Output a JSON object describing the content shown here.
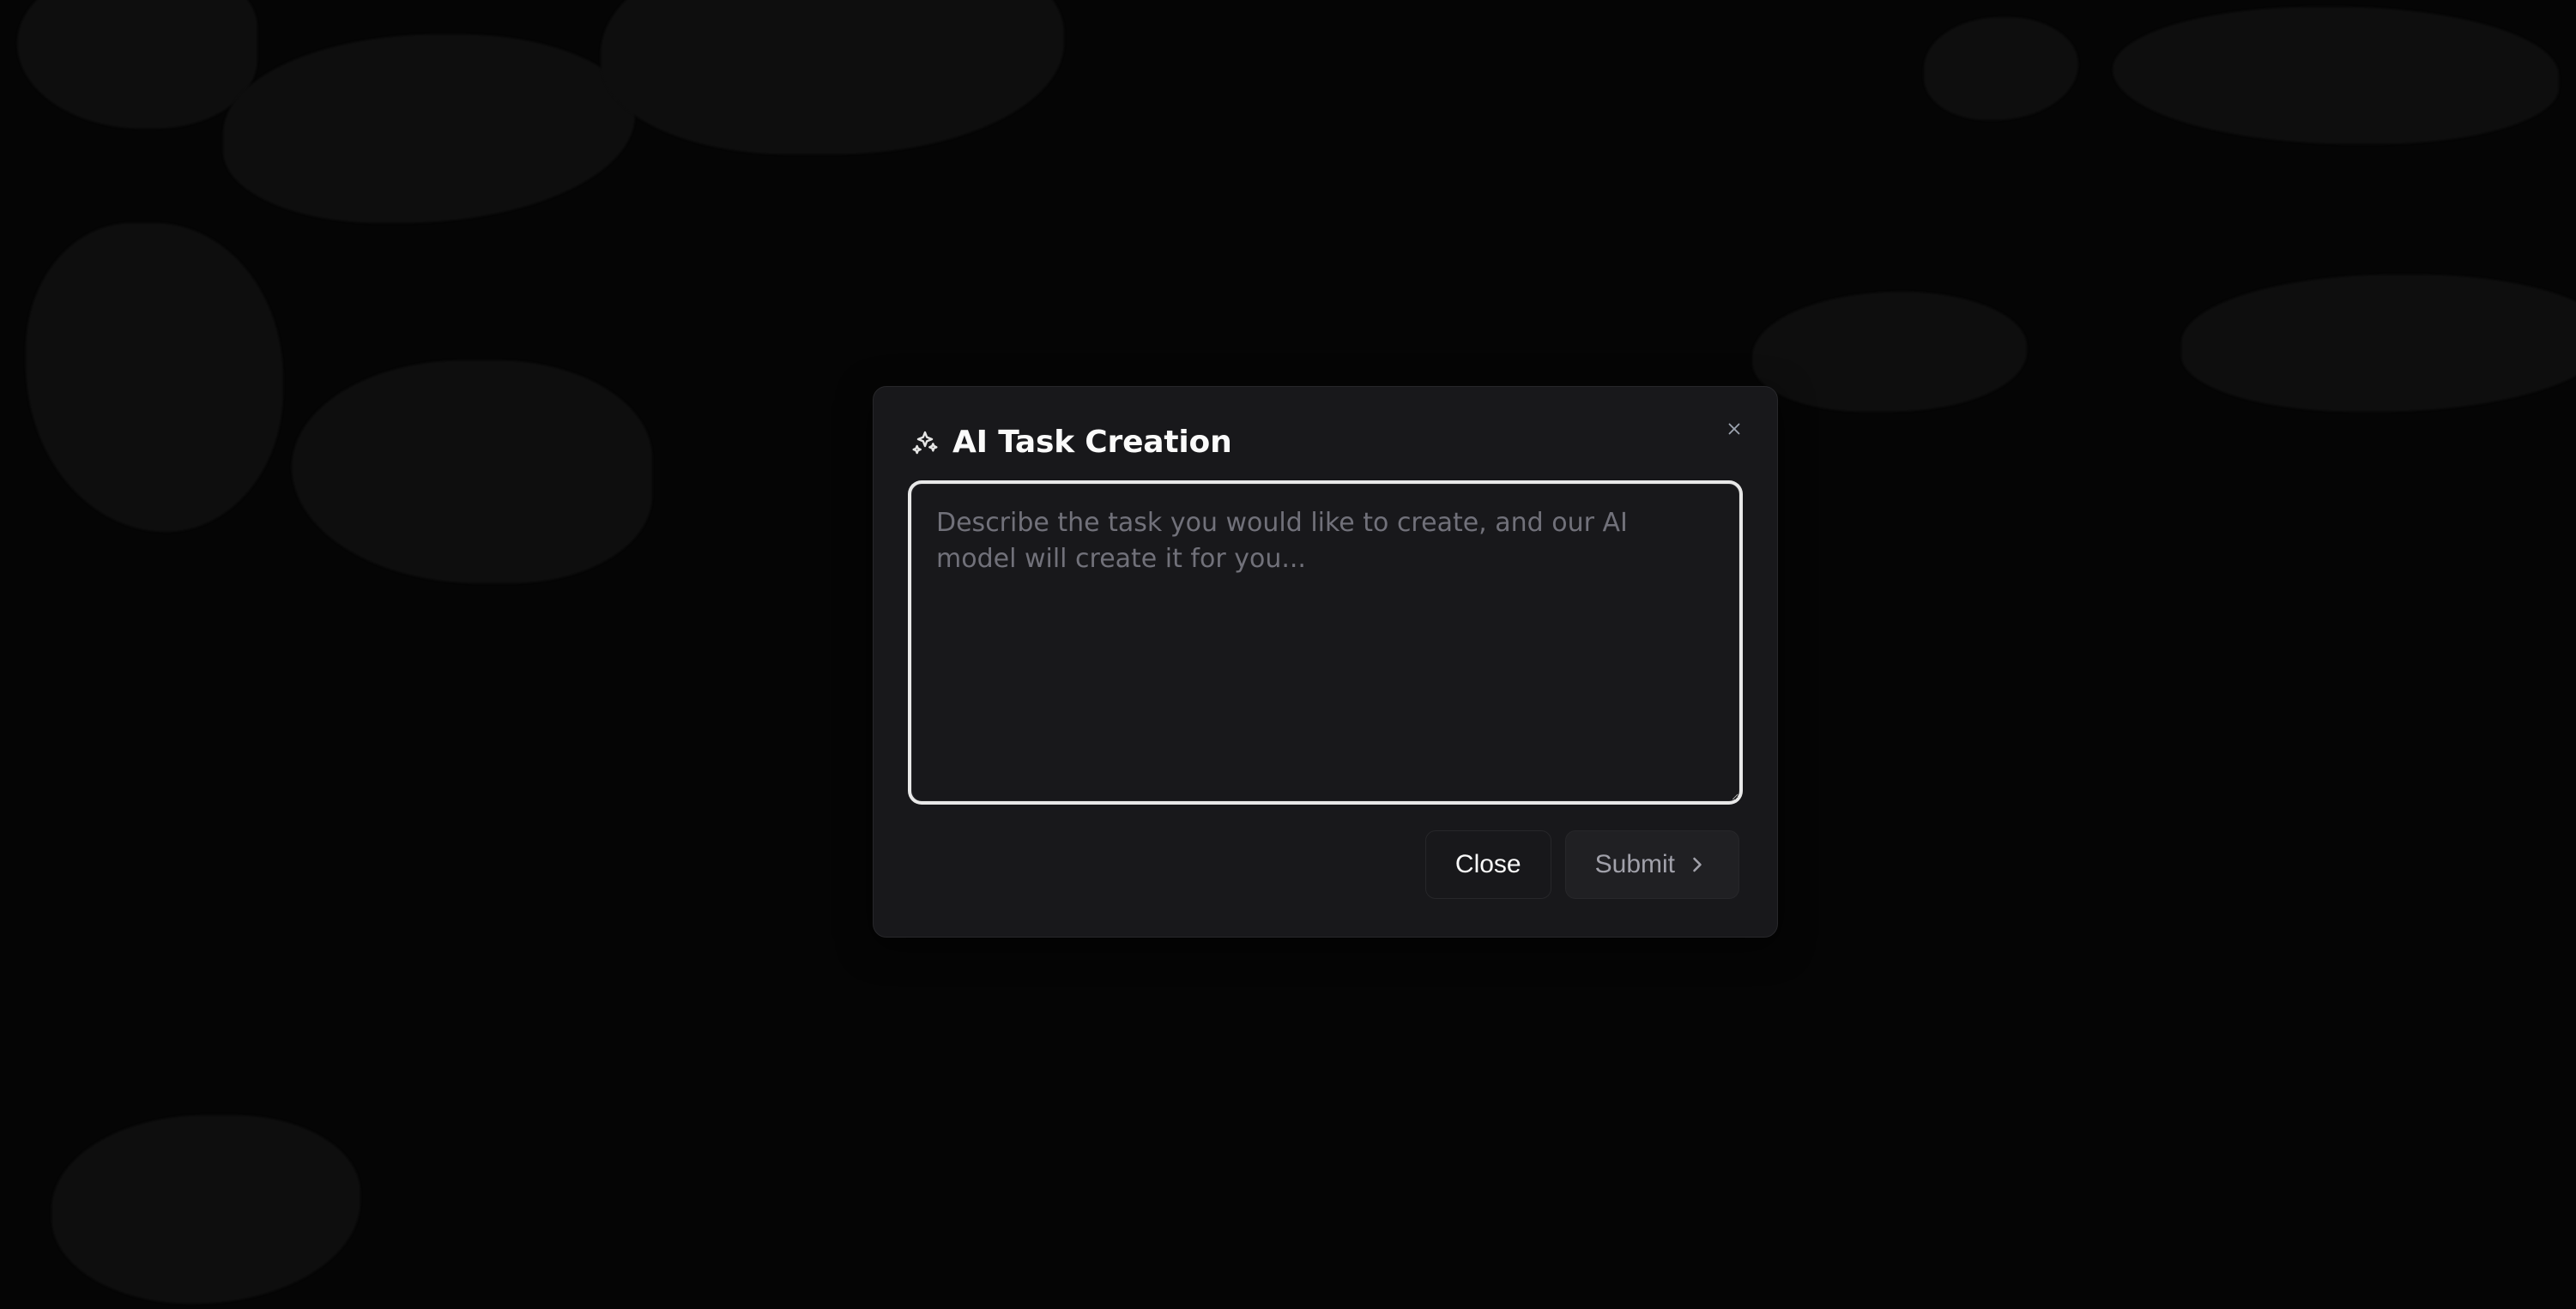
{
  "modal": {
    "title": "AI Task Creation",
    "icon": "sparkles-icon",
    "close_icon": "x-icon"
  },
  "textarea": {
    "value": "",
    "placeholder": "Describe the task you would like to create, and our AI model will create it for you..."
  },
  "buttons": {
    "close": "Close",
    "submit": "Submit",
    "submit_icon": "chevron-right-icon"
  }
}
